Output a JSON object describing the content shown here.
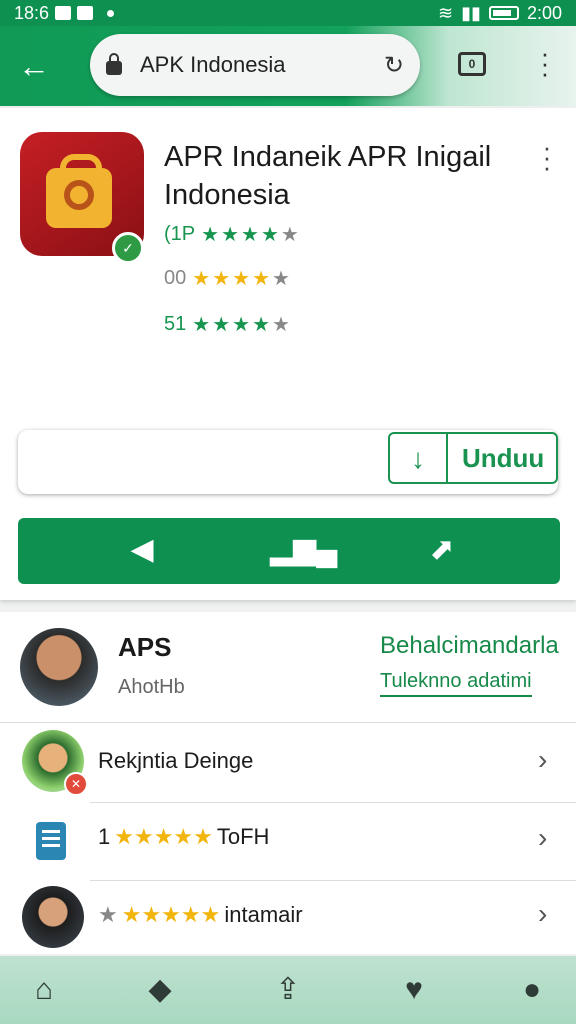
{
  "status_bar": {
    "time": "18:6",
    "right_time": "2:00"
  },
  "browser": {
    "url": "APK Indonesia"
  },
  "app_card": {
    "title": "APR Indaneik APR Inigail Indonesia",
    "ratings": [
      {
        "prefix": "(1P",
        "star_color": "#16954f",
        "stars": 4,
        "rating_fraction": 0.9
      },
      {
        "prefix": "00",
        "star_color": "#f2b50e",
        "stars": 4,
        "rating_fraction": 0.9
      },
      {
        "prefix": "51",
        "star_color": "#16954f",
        "stars": 4,
        "rating_fraction": 0.9
      }
    ],
    "download_label": "Unduu"
  },
  "action_bar": {
    "icons": [
      "speaker-icon",
      "chart-icon",
      "share-icon"
    ]
  },
  "list": {
    "header": {
      "name": "APS",
      "subtitle": "AhotHb",
      "link_primary": "Behalcimandarla",
      "link_secondary": "Tuleknno adatimi"
    },
    "rows": [
      {
        "label": "Rekjntia Deinge"
      },
      {
        "prefix": "1",
        "label": "ToFH",
        "stars": 5
      },
      {
        "label": "intamair",
        "stars": 5
      }
    ]
  },
  "bottom_nav": {
    "items": [
      "home-icon",
      "tag-icon",
      "share-icon",
      "heart-icon",
      "profile-icon"
    ]
  },
  "colors": {
    "brand": "#0e9150",
    "accent": "#19934f",
    "star": "#f2b50e"
  }
}
